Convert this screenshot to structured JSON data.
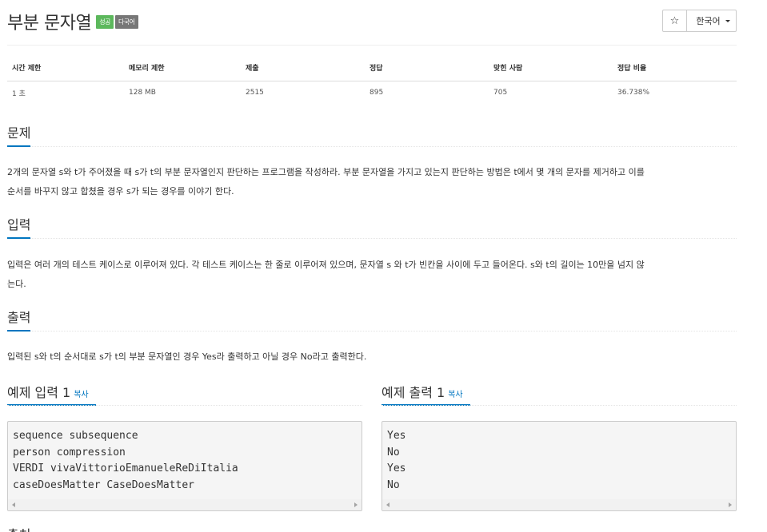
{
  "problem": {
    "title": "부분 문자열",
    "badges": {
      "success": "성공",
      "multilang": "다국어"
    },
    "star_icon": "☆",
    "language_button": "한국어"
  },
  "info": {
    "headers": [
      "시간 제한",
      "메모리 제한",
      "제출",
      "정답",
      "맞힌 사람",
      "정답 비율"
    ],
    "values": [
      "1 초",
      "128 MB",
      "2515",
      "895",
      "705",
      "36.738%"
    ]
  },
  "sections": {
    "description": {
      "title": "문제",
      "lines": [
        "2개의 문자열 s와 t가 주어졌을 때 s가 t의 부분 문자열인지 판단하는 프로그램을 작성하라. 부분 문자열을 가지고 있는지 판단하는 방법은 t에서 몇 개의 문자를 제거하고 이를",
        "순서를 바꾸지 않고 합쳤을 경우 s가 되는 경우를 이야기 한다."
      ]
    },
    "input": {
      "title": "입력",
      "lines": [
        "입력은 여러 개의 테스트 케이스로 이루어져 있다. 각 테스트 케이스는 한 줄로 이루어져 있으며, 문자열 s 와 t가 빈칸을 사이에 두고 들어온다. s와 t의 길이는 10만을 넘지 않",
        "는다."
      ]
    },
    "output": {
      "title": "출력",
      "lines": [
        "입력된 s와 t의 순서대로 s가 t의 부분 문자열인 경우 Yes라 출력하고 아닐 경우 No라고 출력한다."
      ]
    }
  },
  "samples": {
    "input": {
      "title": "예제 입력 1",
      "copy": "복사",
      "lines": [
        "sequence subsequence",
        "person compression",
        "VERDI vivaVittorioEmanueleReDiItalia",
        "caseDoesMatter CaseDoesMatter"
      ]
    },
    "output": {
      "title": "예제 출력 1",
      "copy": "복사",
      "lines": [
        "Yes",
        "No",
        "Yes",
        "No"
      ]
    }
  },
  "next_section_partial": "출처"
}
